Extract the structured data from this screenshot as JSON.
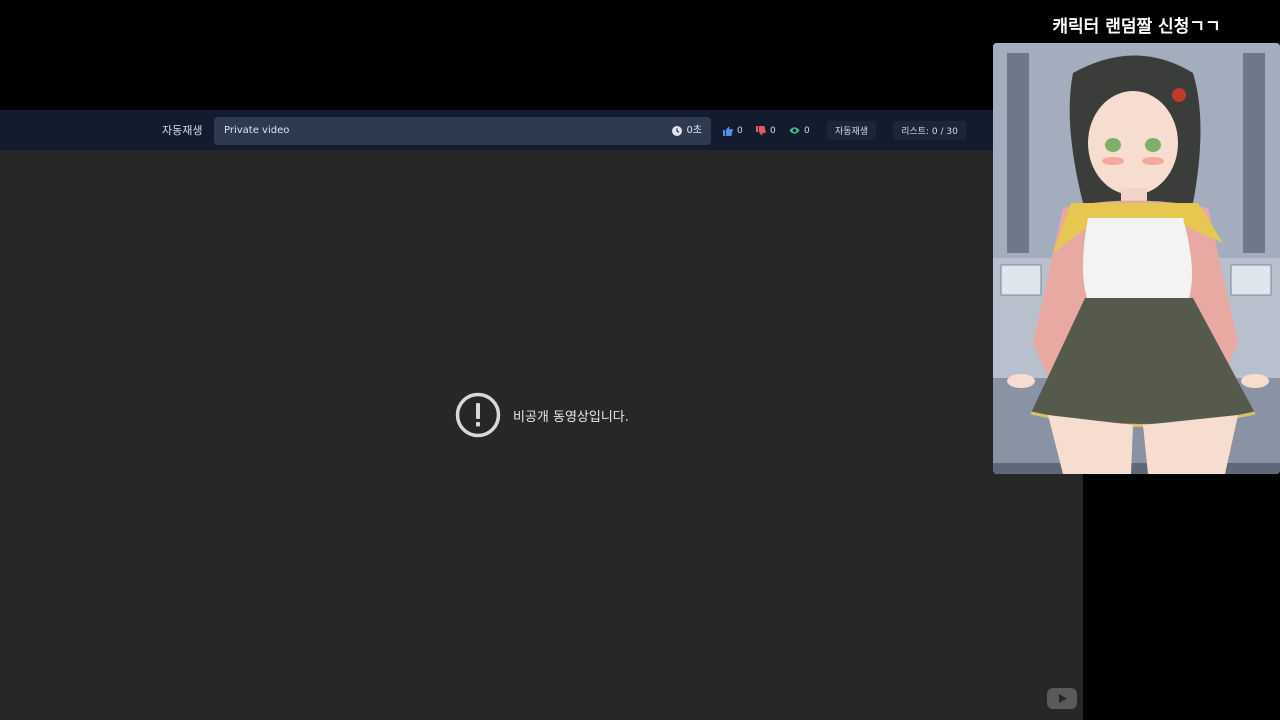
{
  "topbar": {
    "autoplay_label": "자동재생",
    "title_field": "Private video",
    "duration": "0초",
    "likes": "0",
    "dislikes": "0",
    "views": "0",
    "autoplay_button": "자동재생",
    "list_counter": "리스트: 0 / 30"
  },
  "player": {
    "message": "비공개 동영상입니다."
  },
  "promo": {
    "title": "캐릭터 랜덤짤 신청ㄱㄱ"
  },
  "colors": {
    "like": "#4f8fe6",
    "dislike": "#e65a5a",
    "views": "#3cc28a"
  },
  "icons": {
    "clock": "clock-icon",
    "like": "thumbs-up-icon",
    "dislike": "thumbs-down-icon",
    "views": "eye-icon",
    "alert": "alert-circle-icon",
    "youtube": "youtube-logo-icon"
  }
}
